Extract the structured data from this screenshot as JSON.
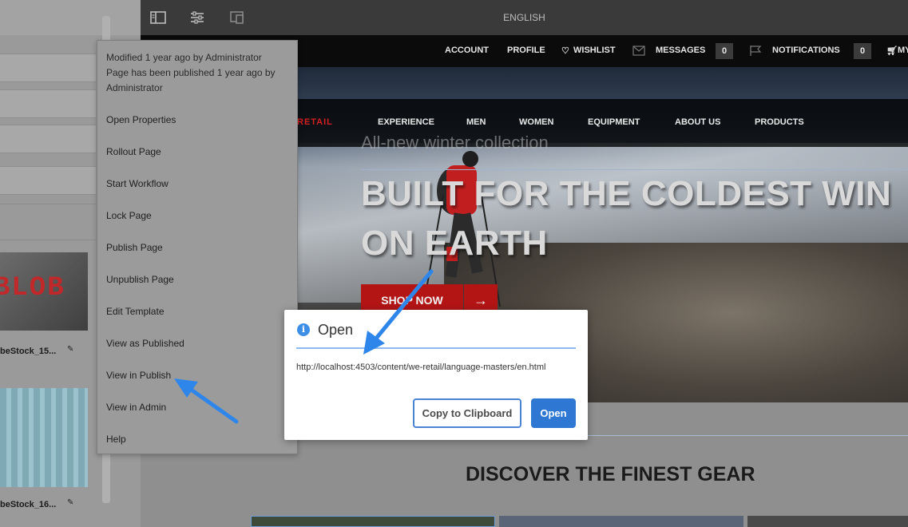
{
  "toolbar": {
    "language": "ENGLISH",
    "icons": [
      "side-panel-icon",
      "page-properties-icon",
      "emulator-icon"
    ]
  },
  "site_topbar": {
    "account": "ACCOUNT",
    "profile": "PROFILE",
    "wishlist": "WISHLIST",
    "messages": "MESSAGES",
    "messages_count": "0",
    "notifications": "NOTIFICATIONS",
    "notifications_count": "0",
    "cart_fragment": "MY"
  },
  "nav": {
    "brand_fragment": "RETAIL",
    "items": [
      "EXPERIENCE",
      "MEN",
      "WOMEN",
      "EQUIPMENT",
      "ABOUT US",
      "PRODUCTS"
    ]
  },
  "hero": {
    "subtitle": "All-new winter collection",
    "title_line1": "BUILT FOR THE COLDEST WIN",
    "title_line2": "ON EARTH",
    "shop_button": "SHOP NOW",
    "shop_arrow": "→"
  },
  "page": {
    "section_heading": "DISCOVER THE FINEST GEAR"
  },
  "left_rail": {
    "thumb_text": "BLOB",
    "assets": [
      "beStock_15...",
      "beStock_16..."
    ]
  },
  "context_menu": {
    "meta_line1": "Modified 1 year ago by Administrator",
    "meta_line2": "Page has been published 1 year ago by Administrator",
    "items": [
      "Open Properties",
      "Rollout Page",
      "Start Workflow",
      "Lock Page",
      "Publish Page",
      "Unpublish Page",
      "Edit Template",
      "View as Published",
      "View in Publish",
      "View in Admin",
      "Help"
    ]
  },
  "dialog": {
    "title": "Open",
    "info_glyph": "i",
    "url": "http://localhost:4503/content/we-retail/language-masters/en.html",
    "copy_button": "Copy to Clipboard",
    "open_button": "Open"
  },
  "colors": {
    "accent_blue": "#2e78d4",
    "brand_red": "#b31515",
    "annotation_arrow": "#2f86ea"
  }
}
